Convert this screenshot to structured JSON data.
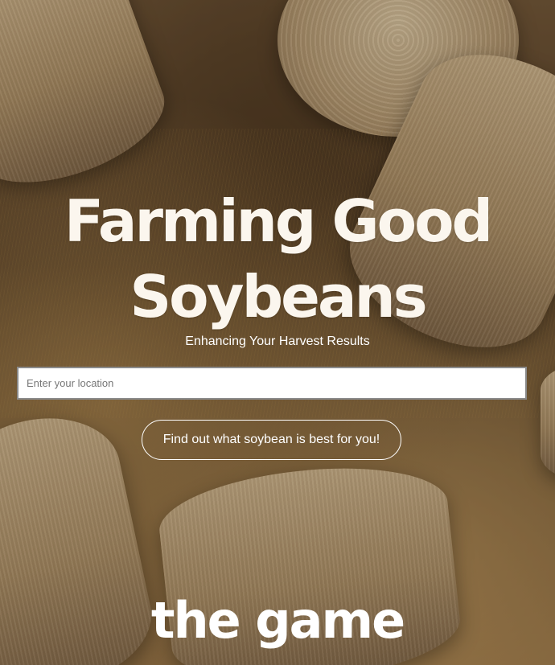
{
  "hero": {
    "headline_line1": "Farming Good",
    "headline_line2": "Soybeans",
    "subtitle": "Enhancing Your Harvest Results"
  },
  "search": {
    "value": "",
    "placeholder": "Enter your location"
  },
  "cta": {
    "label": "Find out what soybean is best for you!"
  },
  "brand": {
    "logo_text": "the game"
  },
  "colors": {
    "headline": "#fbf6ee",
    "text": "#ffffff",
    "input_border": "#8a8a8a"
  }
}
